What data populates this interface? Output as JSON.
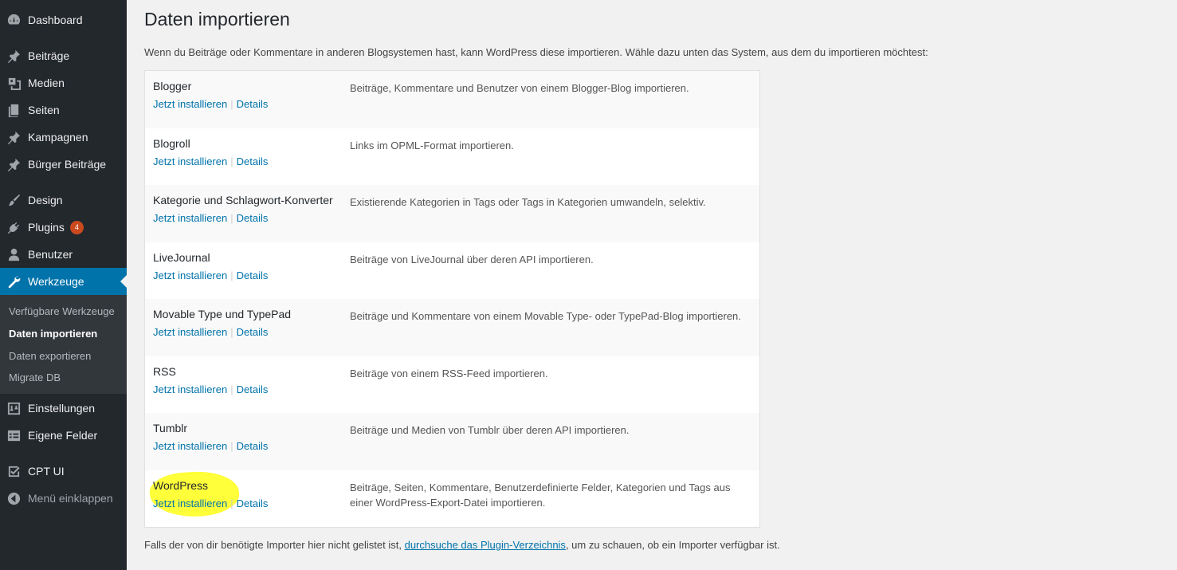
{
  "sidebar": {
    "items": [
      {
        "label": "Dashboard",
        "icon": "dashboard-icon"
      },
      {
        "label": "Beiträge",
        "icon": "pin-icon"
      },
      {
        "label": "Medien",
        "icon": "media-icon"
      },
      {
        "label": "Seiten",
        "icon": "pages-icon"
      },
      {
        "label": "Kampagnen",
        "icon": "pin-icon"
      },
      {
        "label": "Bürger Beiträge",
        "icon": "pin-icon"
      },
      {
        "label": "Design",
        "icon": "brush-icon"
      },
      {
        "label": "Plugins",
        "icon": "plugin-icon",
        "badge": "4"
      },
      {
        "label": "Benutzer",
        "icon": "user-icon"
      },
      {
        "label": "Werkzeuge",
        "icon": "wrench-icon",
        "active": true
      },
      {
        "label": "Einstellungen",
        "icon": "settings-icon"
      },
      {
        "label": "Eigene Felder",
        "icon": "table-icon"
      },
      {
        "label": "CPT UI",
        "icon": "checkbox-icon"
      }
    ],
    "submenu": [
      {
        "label": "Verfügbare Werkzeuge"
      },
      {
        "label": "Daten importieren",
        "current": true
      },
      {
        "label": "Daten exportieren"
      },
      {
        "label": "Migrate DB"
      }
    ],
    "collapse_label": "Menü einklappen"
  },
  "page": {
    "title": "Daten importieren",
    "intro": "Wenn du Beiträge oder Kommentare in anderen Blogsystemen hast, kann WordPress diese importieren. Wähle dazu unten das System, aus dem du importieren möchtest:",
    "install_label": "Jetzt installieren",
    "details_label": "Details",
    "separator": "|",
    "importers": [
      {
        "name": "Blogger",
        "description": "Beiträge, Kommentare und Benutzer von einem Blogger-Blog importieren."
      },
      {
        "name": "Blogroll",
        "description": "Links im OPML-Format importieren."
      },
      {
        "name": "Kategorie und Schlagwort-Konverter",
        "description": "Existierende Kategorien in Tags oder Tags in Kategorien umwandeln, selektiv."
      },
      {
        "name": "LiveJournal",
        "description": "Beiträge von LiveJournal über deren API importieren."
      },
      {
        "name": "Movable Type und TypePad",
        "description": "Beiträge und Kommentare von einem Movable Type- oder TypePad-Blog importieren."
      },
      {
        "name": "RSS",
        "description": "Beiträge von einem RSS-Feed importieren."
      },
      {
        "name": "Tumblr",
        "description": "Beiträge und Medien von Tumblr über deren API importieren."
      },
      {
        "name": "WordPress",
        "description": "Beiträge, Seiten, Kommentare, Benutzerdefinierte Felder, Kategorien und Tags aus einer WordPress-Export-Datei importieren.",
        "highlighted": true
      }
    ],
    "footer": {
      "before": "Falls der von dir benötigte Importer hier nicht gelistet ist, ",
      "link": "durchsuche das Plugin-Verzeichnis",
      "after": ", um zu schauen, ob ein Importer verfügbar ist."
    }
  },
  "colors": {
    "sidebar_bg": "#23282d",
    "submenu_bg": "#32373c",
    "active": "#0073aa",
    "link": "#0073aa",
    "badge": "#ca4a1f",
    "highlight": "#ffff3a"
  }
}
